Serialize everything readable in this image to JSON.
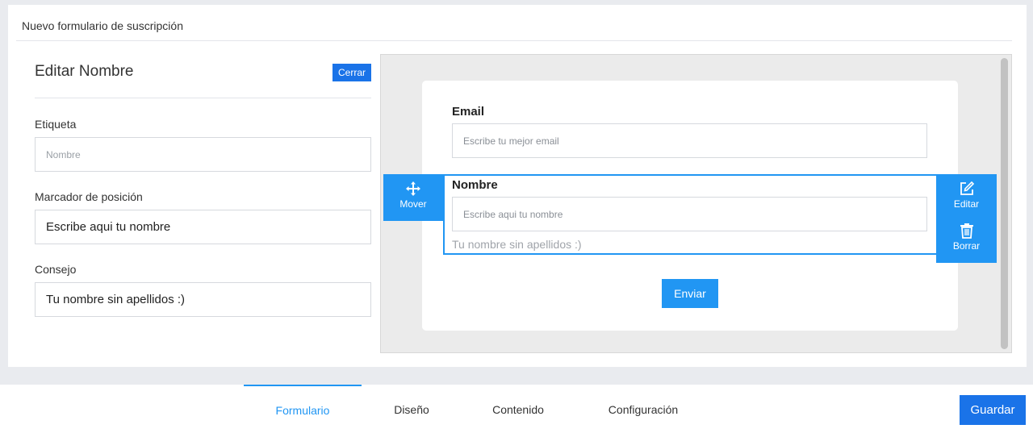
{
  "card": {
    "title": "Nuevo formulario de suscripción"
  },
  "editor": {
    "heading": "Editar Nombre",
    "close_label": "Cerrar",
    "fields": [
      {
        "label": "Etiqueta",
        "value": "",
        "placeholder": "Nombre"
      },
      {
        "label": "Marcador de posición",
        "value": "Escribe aqui tu nombre",
        "placeholder": ""
      },
      {
        "label": "Consejo",
        "value": "Tu nombre sin apellidos :)",
        "placeholder": ""
      }
    ]
  },
  "preview": {
    "email": {
      "label": "Email",
      "placeholder": "Escribe tu mejor email"
    },
    "nombre": {
      "label": "Nombre",
      "placeholder": "Escribe aqui tu nombre",
      "hint": "Tu nombre sin apellidos :)"
    },
    "submit_label": "Enviar",
    "actions": {
      "move": "Mover",
      "edit": "Editar",
      "delete": "Borrar"
    },
    "icons": {
      "move": "move-arrows-icon",
      "edit": "pencil-square-icon",
      "delete": "trash-icon"
    }
  },
  "tabs": [
    {
      "label": "Formulario",
      "active": true
    },
    {
      "label": "Diseño",
      "active": false
    },
    {
      "label": "Contenido",
      "active": false
    },
    {
      "label": "Configuración",
      "active": false
    }
  ],
  "save_label": "Guardar",
  "colors": {
    "accent": "#2196f3",
    "primary_button": "#1a73e8"
  }
}
